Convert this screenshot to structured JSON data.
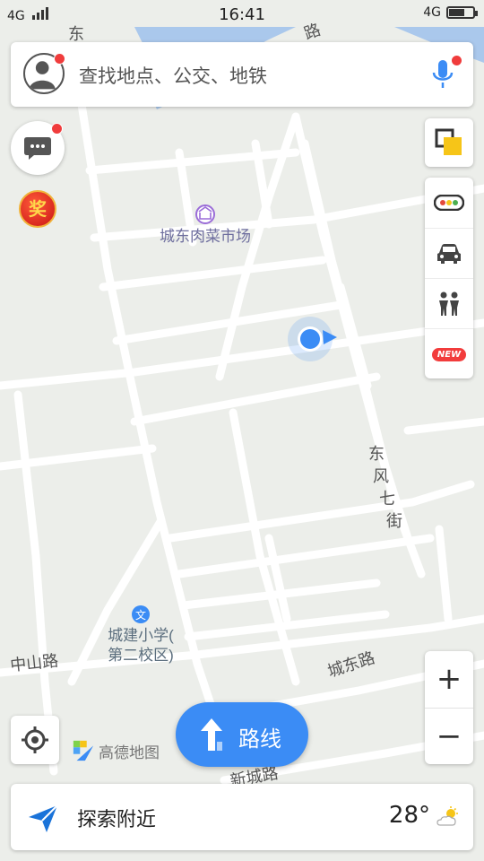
{
  "status_bar": {
    "network_left": "4G",
    "time": "16:41",
    "network_right": "4G"
  },
  "search": {
    "placeholder": "查找地点、公交、地铁"
  },
  "award": {
    "label": "奖"
  },
  "map": {
    "poi_market": "城东肉菜市场",
    "school_line1": "城建小学(",
    "school_line2": "第二校区)",
    "school_icon": "文",
    "street_dongfeng": "东风七街",
    "street_zhongshan": "中山路",
    "street_chengdong": "城东路",
    "street_top_right": "路",
    "street_top_left": "东",
    "street_bottom": "新城路"
  },
  "logo": {
    "text": "高德地图"
  },
  "route_button": {
    "label": "路线"
  },
  "toolbar": {
    "new_badge": "NEW"
  },
  "zoom": {
    "in": "+",
    "out": "−"
  },
  "bottom_bar": {
    "explore": "探索附近",
    "temperature": "28°"
  },
  "colors": {
    "accent": "#3b8cf5",
    "badge": "#f03c3c",
    "map_bg": "#eceeea",
    "road": "#ffffff",
    "water": "#aac8ec"
  }
}
